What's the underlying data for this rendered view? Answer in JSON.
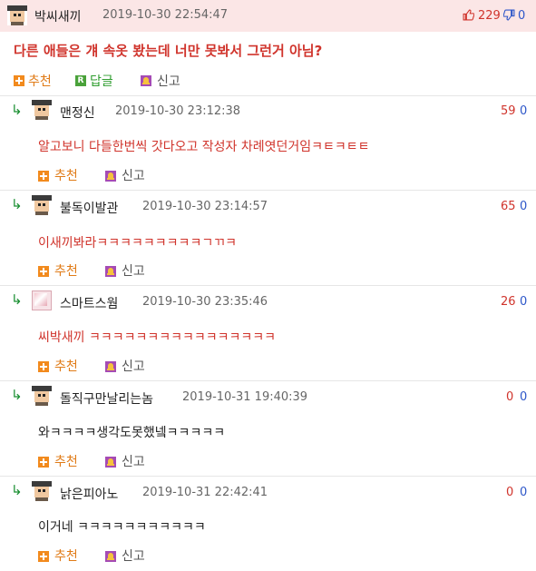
{
  "post": {
    "nick": "박씨새끼",
    "date": "2019-10-30 22:54:47",
    "up": "229",
    "down": "0",
    "title": "다른 애들은 걔 속옷 봤는데 너만 못봐서 그런거 아님?",
    "actions": {
      "recommend": "추천",
      "reply": "답글",
      "report": "신고"
    }
  },
  "comments": [
    {
      "nick": "맨정신",
      "date": "2019-10-30 23:12:38",
      "up": "59",
      "down": "0",
      "text": "알고보니 다들한번씩 갓다오고 작성자 차례엿던거임ㅋㅌㅋㅌㅌ",
      "recommend": "추천",
      "report": "신고"
    },
    {
      "nick": "불독이발관",
      "date": "2019-10-30 23:14:57",
      "up": "65",
      "down": "0",
      "text": "이새끼봐라ㅋㅋㅋㅋㅋㅋㅋㅋㅋㄱㄲㅋ",
      "recommend": "추천",
      "report": "신고"
    },
    {
      "nick": "스마트스웜",
      "date": "2019-10-30 23:35:46",
      "up": "26",
      "down": "0",
      "text": "씨박새끼 ㅋㅋㅋㅋㅋㅋㅋㅋㅋㅋㅋㅋㅋㅋㅋㅋ",
      "recommend": "추천",
      "report": "신고"
    },
    {
      "nick": "돌직구만날리는놈",
      "date": "2019-10-31 19:40:39",
      "up": "0",
      "down": "0",
      "text": "와ㅋㅋㅋㅋ생각도못했넼ㅋㅋㅋㅋㅋ",
      "recommend": "추천",
      "report": "신고"
    },
    {
      "nick": "낡은피아노",
      "date": "2019-10-31 22:42:41",
      "up": "0",
      "down": "0",
      "text": "이거네 ㅋㅋㅋㅋㅋㅋㅋㅋㅋㅋㅋ",
      "recommend": "추천",
      "report": "신고"
    }
  ]
}
